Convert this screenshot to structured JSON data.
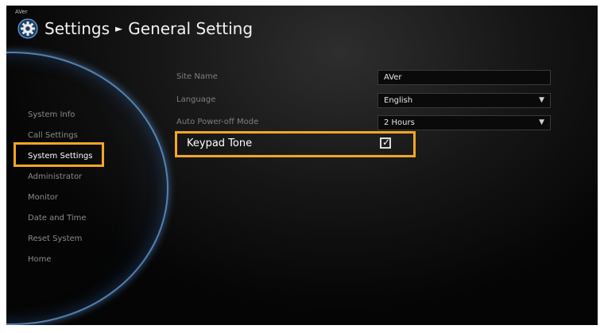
{
  "brand": "AVer",
  "header": {
    "title": "Settings",
    "separator": "►",
    "subtitle": "General Setting"
  },
  "menu": {
    "items": [
      {
        "label": "System Info"
      },
      {
        "label": "Call Settings"
      },
      {
        "label": "System Settings"
      },
      {
        "label": "Administrator"
      },
      {
        "label": "Monitor"
      },
      {
        "label": "Date and Time"
      },
      {
        "label": "Reset System"
      },
      {
        "label": "Home"
      }
    ],
    "active": "System Settings"
  },
  "settings": {
    "site_name": {
      "label": "Site Name",
      "value": "AVer"
    },
    "language": {
      "label": "Language",
      "value": "English",
      "icon": "dropdown-arrow-icon"
    },
    "auto_power_off": {
      "label": "Auto Power-off Mode",
      "value": "2 Hours",
      "icon": "dropdown-arrow-icon"
    },
    "keypad_tone": {
      "label": "Keypad Tone",
      "checked": true
    }
  },
  "colors": {
    "highlight": "#f5a623",
    "arc": "#6eaae6"
  }
}
